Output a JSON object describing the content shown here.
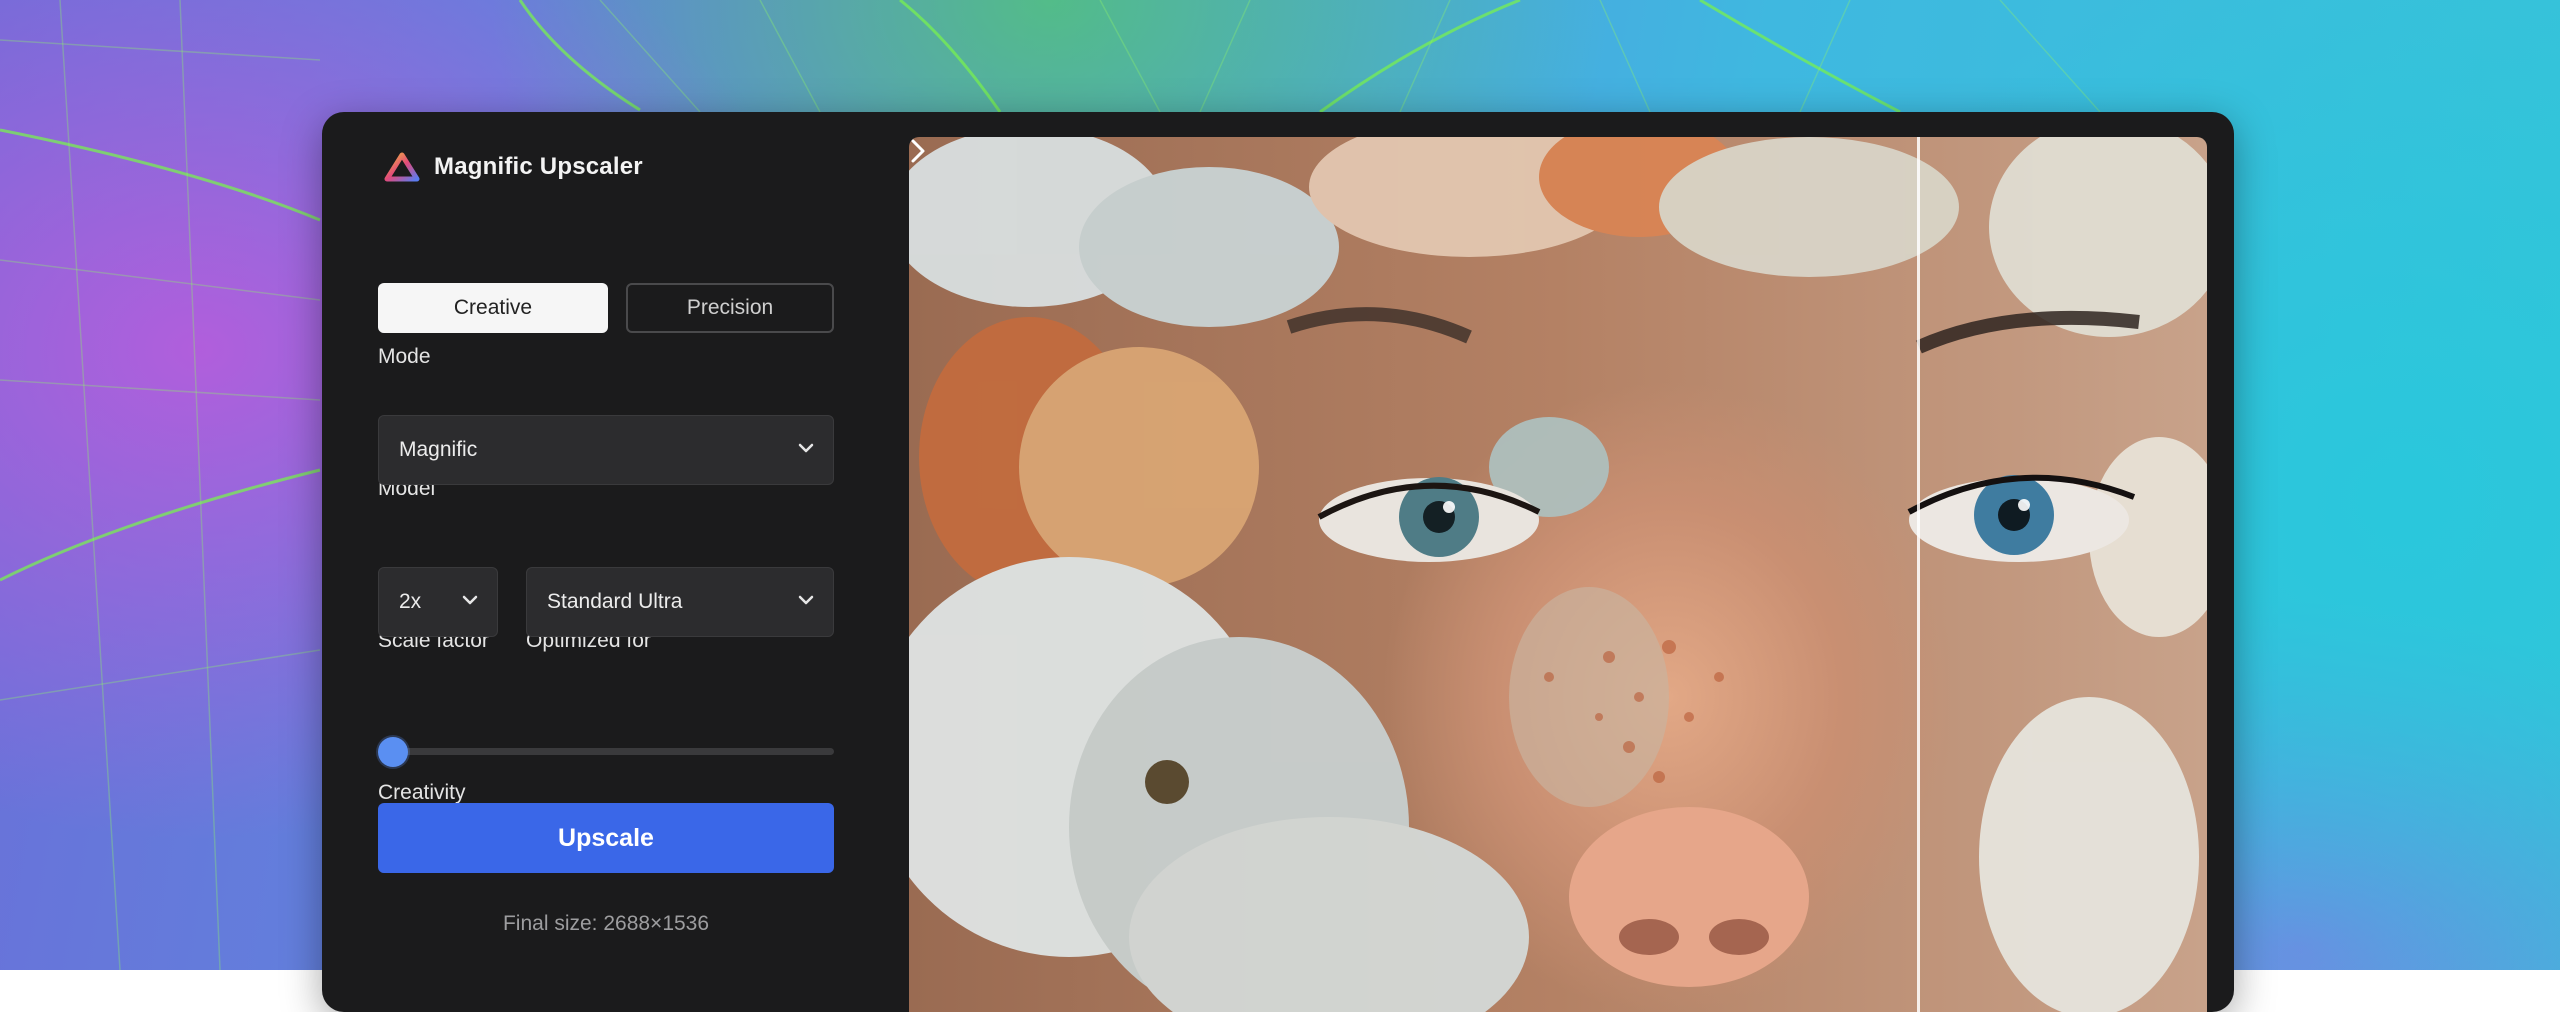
{
  "app": {
    "title": "Magnific Upscaler"
  },
  "mode": {
    "label": "Mode",
    "options": [
      "Creative",
      "Precision"
    ],
    "selected": "Creative"
  },
  "model": {
    "label": "Model",
    "value": "Magnific"
  },
  "scale": {
    "label": "Scale factor",
    "value": "2x"
  },
  "optimized": {
    "label": "Optimized for",
    "value": "Standard Ultra"
  },
  "creativity": {
    "label": "Creativity",
    "level": 0
  },
  "actions": {
    "upscale_label": "Upscale"
  },
  "output": {
    "final_size": "Final size: 2688×1536"
  },
  "colors": {
    "accent": "#3a67e8",
    "panel_bg": "#1b1b1c",
    "input_bg": "#2c2c2e"
  },
  "icons": {
    "logo": "magnific-triangle-icon",
    "dropdown": "chevron-down-icon",
    "compare": "chevron-right-icon"
  }
}
